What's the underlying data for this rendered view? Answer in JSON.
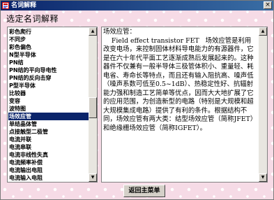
{
  "window": {
    "title": "名词解释",
    "close_label": "×"
  },
  "heading": "选定名词解释",
  "terms": [
    "彩色爬行",
    "不同步",
    "彩色偏色",
    "N型半导体",
    "PN结",
    "PN结的平向导电性",
    "PN结的反向击穿",
    "P型半导体",
    "比较器",
    "变容",
    "波特图",
    "场效应管",
    "单结晶体管",
    "点接触型二极管",
    "电流并联",
    "电流串联",
    "电流非线性失真",
    "电流频率补偿",
    "电流输出电阻",
    "电流输入电阻",
    "电流抑制噪声"
  ],
  "selected_term": "场效应管",
  "definition": "场效应管：\n    Field effect transistor FET   场效应管是利用改变电场，来控制固体材料导电能力的有源器件，它是在六十年代平面工艺逐渐成熟后发展起来的。这种器件不仅兼有一般半导体三极管体积小、重量轻、耗电省、寿命长等特点，而且还有输入阻抗高、噪声低（噪声系数可低至0.5~1dB）、热稳定性好、抗辐射能力强和制造工艺简单等优点，因而大大地扩展了它的应用范围，为创造新型的电路（特别是大规模和超大规模集成电路）提供了有利的条件。根据结构不同，场效应管有两大类：结型场效应管（简称JFET）和绝缘栅场效应管（简称IGFET）。",
  "return_button": "返回主菜单"
}
